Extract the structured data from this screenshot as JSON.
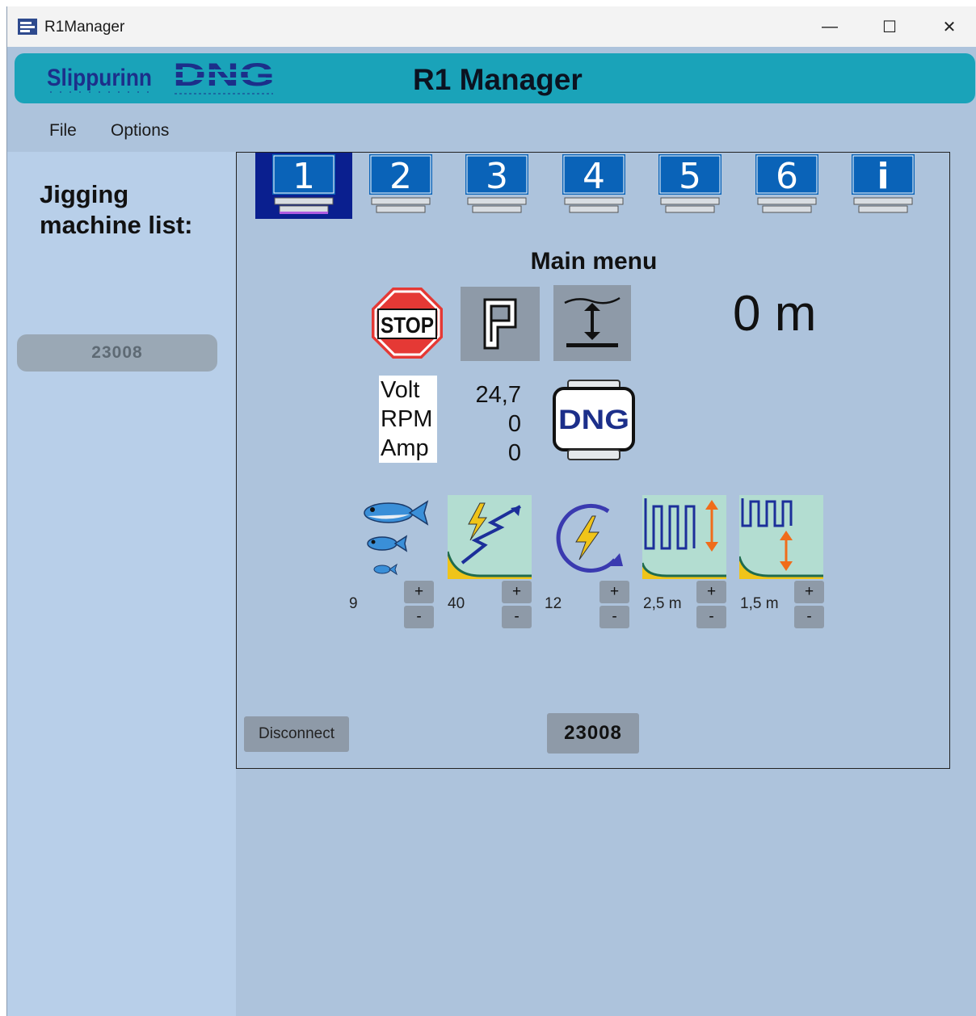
{
  "window": {
    "title": "R1Manager",
    "minimize": "—",
    "maximize": "☐",
    "close": "✕"
  },
  "banner": {
    "logo_text": "Slippurinn",
    "brand": "DNG",
    "title": "R1 Manager"
  },
  "menu": {
    "items": [
      "File",
      "Options"
    ]
  },
  "sidebar": {
    "title": "Jigging machine list:",
    "machines": [
      "23008"
    ]
  },
  "tabs": [
    "1",
    "2",
    "3",
    "4",
    "5",
    "6",
    "i"
  ],
  "main": {
    "title": "Main menu",
    "distance": "0 m",
    "stop_label": "STOP",
    "labels": [
      "Volt",
      "RPM",
      "Amp"
    ],
    "readings": [
      "24,7",
      "0",
      "0"
    ],
    "dng_label": "DNG"
  },
  "features": [
    {
      "icon": "fish-size-icon",
      "value": "9"
    },
    {
      "icon": "pull-strength-icon",
      "value": "40"
    },
    {
      "icon": "speed-cycle-icon",
      "value": "12"
    },
    {
      "icon": "jig-depth-icon",
      "value": "2,5 m"
    },
    {
      "icon": "jig-step-icon",
      "value": "1,5 m"
    }
  ],
  "stepper": {
    "plus": "+",
    "minus": "-"
  },
  "footer": {
    "disconnect": "Disconnect",
    "machine_id": "23008"
  },
  "colors": {
    "banner": "#1aa3b9",
    "background": "#adc3dc",
    "sidebar": "#b8cfe9",
    "tab_blue": "#0a63b8",
    "tab_active": "#0a1f8f"
  }
}
